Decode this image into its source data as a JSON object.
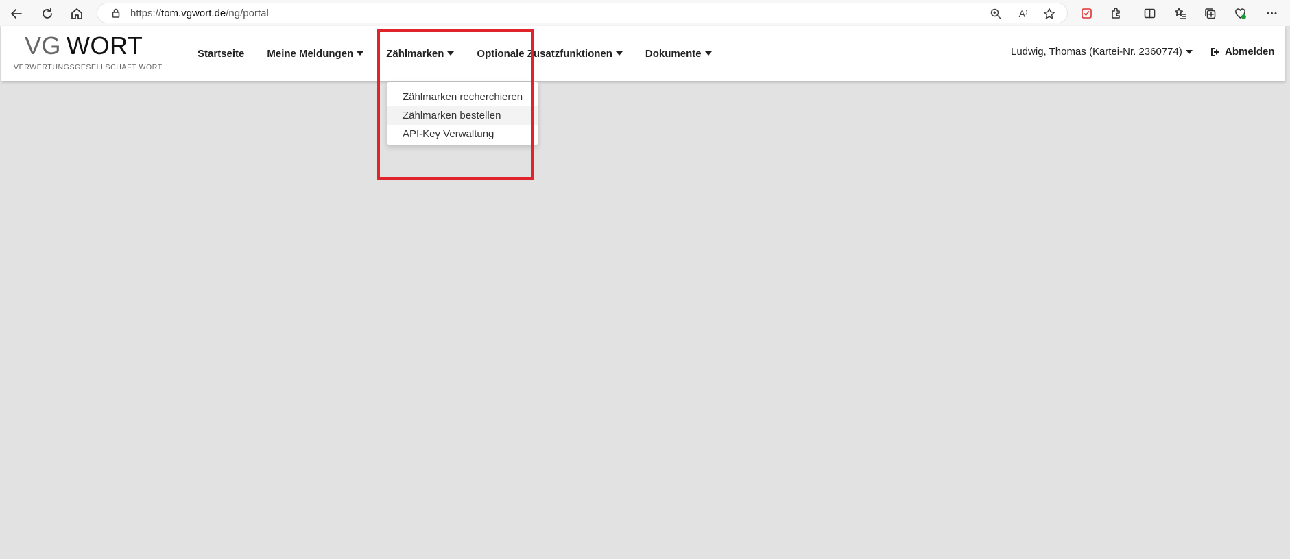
{
  "browser": {
    "url_scheme": "https://",
    "url_host": "tom.vgwort.de",
    "url_path": "/ng/portal",
    "read_aloud_label": "A⁾"
  },
  "logo": {
    "vg": "VG",
    "wort": "WORT",
    "subtitle": "VERWERTUNGSGESELLSCHAFT WORT"
  },
  "nav": {
    "items": [
      {
        "label": "Startseite",
        "caret": false
      },
      {
        "label": "Meine Meldungen",
        "caret": true
      },
      {
        "label": "Zählmarken",
        "caret": true
      },
      {
        "label": "Optionale Zusatzfunktionen",
        "caret": true
      },
      {
        "label": "Dokumente",
        "caret": true
      }
    ]
  },
  "user": {
    "name": "Ludwig, Thomas (Kartei-Nr. 2360774)"
  },
  "logout_label": "Abmelden",
  "dropdown": {
    "items": [
      {
        "label": "Zählmarken recherchieren"
      },
      {
        "label": "Zählmarken bestellen",
        "hovered": true
      },
      {
        "label": "API-Key Verwaltung"
      }
    ]
  },
  "colors": {
    "highlight": "#e0242b",
    "page_background": "#e2e2e2"
  }
}
